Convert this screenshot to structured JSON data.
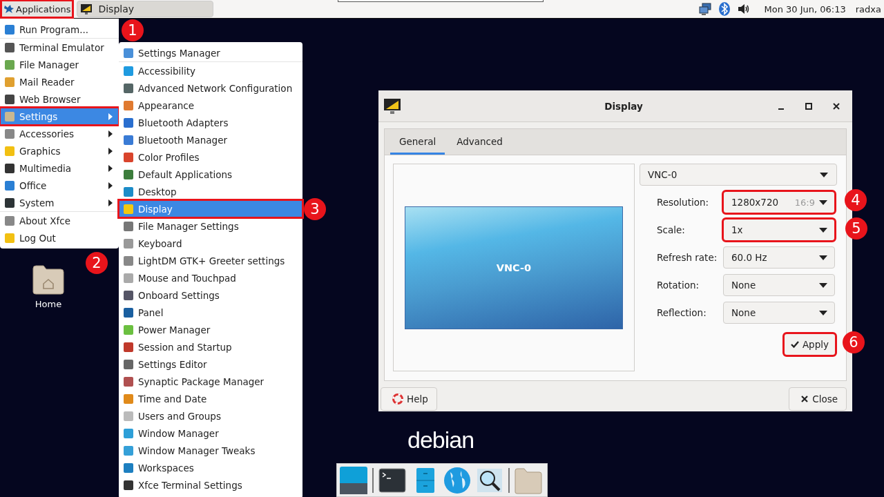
{
  "top_panel": {
    "applications_button": {
      "label": "Applications",
      "highlighted": true
    },
    "tasks": [
      {
        "label": "Display",
        "selected": false
      }
    ],
    "clock": "Mon 30 Jun, 06:13",
    "user": "radxa"
  },
  "applications_menu": {
    "groups": [
      [
        {
          "label": "Run Program...",
          "submenu": false,
          "selected": false,
          "highlighted": false
        }
      ],
      [
        {
          "label": "Terminal Emulator",
          "submenu": false,
          "selected": false,
          "highlighted": false
        },
        {
          "label": "File Manager",
          "submenu": false,
          "selected": false,
          "highlighted": false
        },
        {
          "label": "Mail Reader",
          "submenu": false,
          "selected": false,
          "highlighted": false
        },
        {
          "label": "Web Browser",
          "submenu": false,
          "selected": false,
          "highlighted": false
        },
        {
          "label": "Settings",
          "submenu": true,
          "selected": true,
          "highlighted": true
        },
        {
          "label": "Accessories",
          "submenu": true,
          "selected": false,
          "highlighted": false
        },
        {
          "label": "Graphics",
          "submenu": true,
          "selected": false,
          "highlighted": false
        },
        {
          "label": "Multimedia",
          "submenu": true,
          "selected": false,
          "highlighted": false
        },
        {
          "label": "Office",
          "submenu": true,
          "selected": false,
          "highlighted": false
        },
        {
          "label": "System",
          "submenu": true,
          "selected": false,
          "highlighted": false
        }
      ],
      [
        {
          "label": "About Xfce",
          "submenu": false,
          "selected": false,
          "highlighted": false
        },
        {
          "label": "Log Out",
          "submenu": false,
          "selected": false,
          "highlighted": false
        }
      ]
    ]
  },
  "settings_menu": {
    "groups": [
      [
        {
          "label": "Settings Manager",
          "selected": false,
          "highlighted": false
        }
      ],
      [
        {
          "label": "Accessibility",
          "selected": false,
          "highlighted": false
        },
        {
          "label": "Advanced Network Configuration",
          "selected": false,
          "highlighted": false
        },
        {
          "label": "Appearance",
          "selected": false,
          "highlighted": false
        },
        {
          "label": "Bluetooth Adapters",
          "selected": false,
          "highlighted": false
        },
        {
          "label": "Bluetooth Manager",
          "selected": false,
          "highlighted": false
        },
        {
          "label": "Color Profiles",
          "selected": false,
          "highlighted": false
        },
        {
          "label": "Default Applications",
          "selected": false,
          "highlighted": false
        },
        {
          "label": "Desktop",
          "selected": false,
          "highlighted": false
        },
        {
          "label": "Display",
          "selected": true,
          "highlighted": true
        },
        {
          "label": "File Manager Settings",
          "selected": false,
          "highlighted": false
        },
        {
          "label": "Keyboard",
          "selected": false,
          "highlighted": false
        },
        {
          "label": "LightDM GTK+ Greeter settings",
          "selected": false,
          "highlighted": false
        },
        {
          "label": "Mouse and Touchpad",
          "selected": false,
          "highlighted": false
        },
        {
          "label": "Onboard Settings",
          "selected": false,
          "highlighted": false
        },
        {
          "label": "Panel",
          "selected": false,
          "highlighted": false
        },
        {
          "label": "Power Manager",
          "selected": false,
          "highlighted": false
        },
        {
          "label": "Session and Startup",
          "selected": false,
          "highlighted": false
        },
        {
          "label": "Settings Editor",
          "selected": false,
          "highlighted": false
        },
        {
          "label": "Synaptic Package Manager",
          "selected": false,
          "highlighted": false
        },
        {
          "label": "Time and Date",
          "selected": false,
          "highlighted": false
        },
        {
          "label": "Users and Groups",
          "selected": false,
          "highlighted": false
        },
        {
          "label": "Window Manager",
          "selected": false,
          "highlighted": false
        },
        {
          "label": "Window Manager Tweaks",
          "selected": false,
          "highlighted": false
        },
        {
          "label": "Workspaces",
          "selected": false,
          "highlighted": false
        },
        {
          "label": "Xfce Terminal Settings",
          "selected": false,
          "highlighted": false
        }
      ]
    ]
  },
  "desktop_icons": [
    {
      "label": "Home"
    }
  ],
  "dialog": {
    "title": "Display",
    "tabs": [
      {
        "label": "General",
        "selected": true
      },
      {
        "label": "Advanced",
        "selected": false
      }
    ],
    "preview_label": "VNC-0",
    "output_select": "VNC-0",
    "fields": [
      {
        "label": "Resolution:",
        "value": "1280x720",
        "aspect": "16:9",
        "highlighted": true
      },
      {
        "label": "Scale:",
        "value": "1x",
        "highlighted": true
      },
      {
        "label": "Refresh rate:",
        "value": "60.0 Hz",
        "highlighted": false
      },
      {
        "label": "Rotation:",
        "value": "None",
        "highlighted": false
      },
      {
        "label": "Reflection:",
        "value": "None",
        "highlighted": false
      }
    ],
    "apply_button": {
      "label": "Apply",
      "highlighted": true
    },
    "help_button": "Help",
    "close_button": "Close"
  },
  "logo": "debian",
  "callouts": [
    "1",
    "2",
    "3",
    "4",
    "5",
    "6"
  ]
}
